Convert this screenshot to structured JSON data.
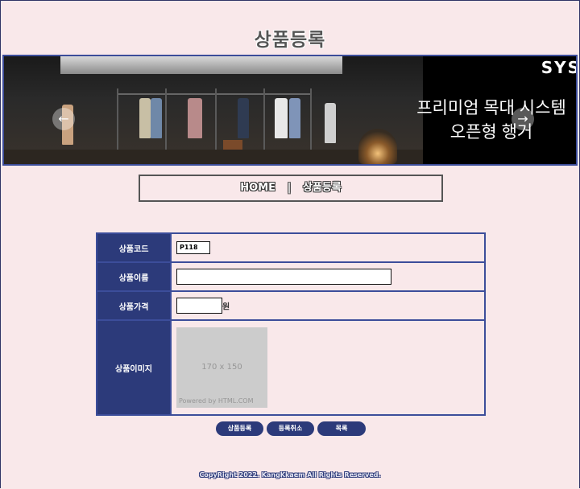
{
  "page": {
    "title": "상품등록"
  },
  "banner": {
    "brand": "SYS",
    "headline_line1": "프리미엄 목대 시스템",
    "headline_line2": "오픈형 행거",
    "prev_icon": "chevron-left-icon",
    "next_icon": "chevron-right-icon"
  },
  "breadcrumb": {
    "home": "HOME",
    "separator": "|",
    "current": "상품등록"
  },
  "form": {
    "code_label": "상품코드",
    "code_value": "P118",
    "name_label": "상품이름",
    "name_value": "",
    "price_label": "상품가격",
    "price_value": "",
    "price_unit": "원",
    "image_label": "상품이미지",
    "image_placeholder_size": "170 x 150",
    "image_placeholder_credit": "Powered by HTML.COM"
  },
  "buttons": {
    "register": "상품등록",
    "cancel": "등록취소",
    "list": "목록"
  },
  "footer": {
    "copyright": "CopyRight 2022. KangKkaem All Rights Reserved."
  }
}
